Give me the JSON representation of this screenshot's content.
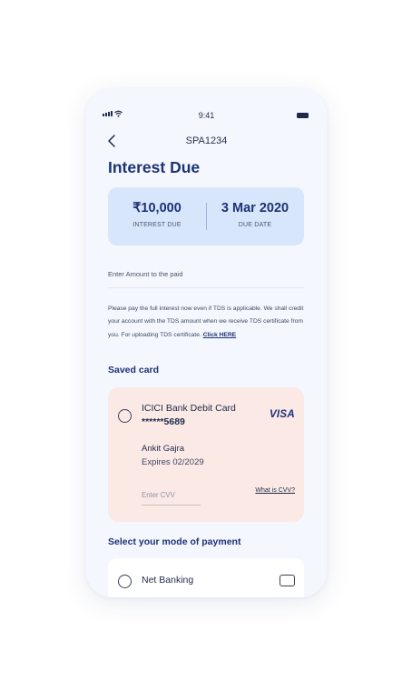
{
  "status_bar": {
    "time": "9:41"
  },
  "nav": {
    "title": "SPA1234"
  },
  "page": {
    "heading": "Interest Due"
  },
  "summary": {
    "interest_value": "₹10,000",
    "interest_label": "INTEREST DUE",
    "date_value": "3 Mar 2020",
    "date_label": "DUE DATE"
  },
  "amount": {
    "placeholder": "Enter Amount to the paid"
  },
  "note": {
    "text": "Please pay the full interest now even if TDS is applicable. We shall credit your account with the TDS amount when we receive TDS certificate from you. For uploading TDS certificate.",
    "link": "Click HERE"
  },
  "saved_card": {
    "section_title": "Saved card",
    "card_name": "ICICI Bank Debit Card",
    "card_number": "******5689",
    "network": "VISA",
    "holder": "Ankit Gajra",
    "expiry": "Expires 02/2029",
    "cvv_placeholder": "Enter CVV",
    "what_cvv": "What is CVV?"
  },
  "payment_mode": {
    "section_title": "Select your mode of payment",
    "option_label": "Net Banking"
  },
  "colors": {
    "screen_bg": "#f4f7fd",
    "primary": "#1c3275",
    "summary_bg": "#d8e6fb",
    "card_bg": "#fbe9e6"
  }
}
